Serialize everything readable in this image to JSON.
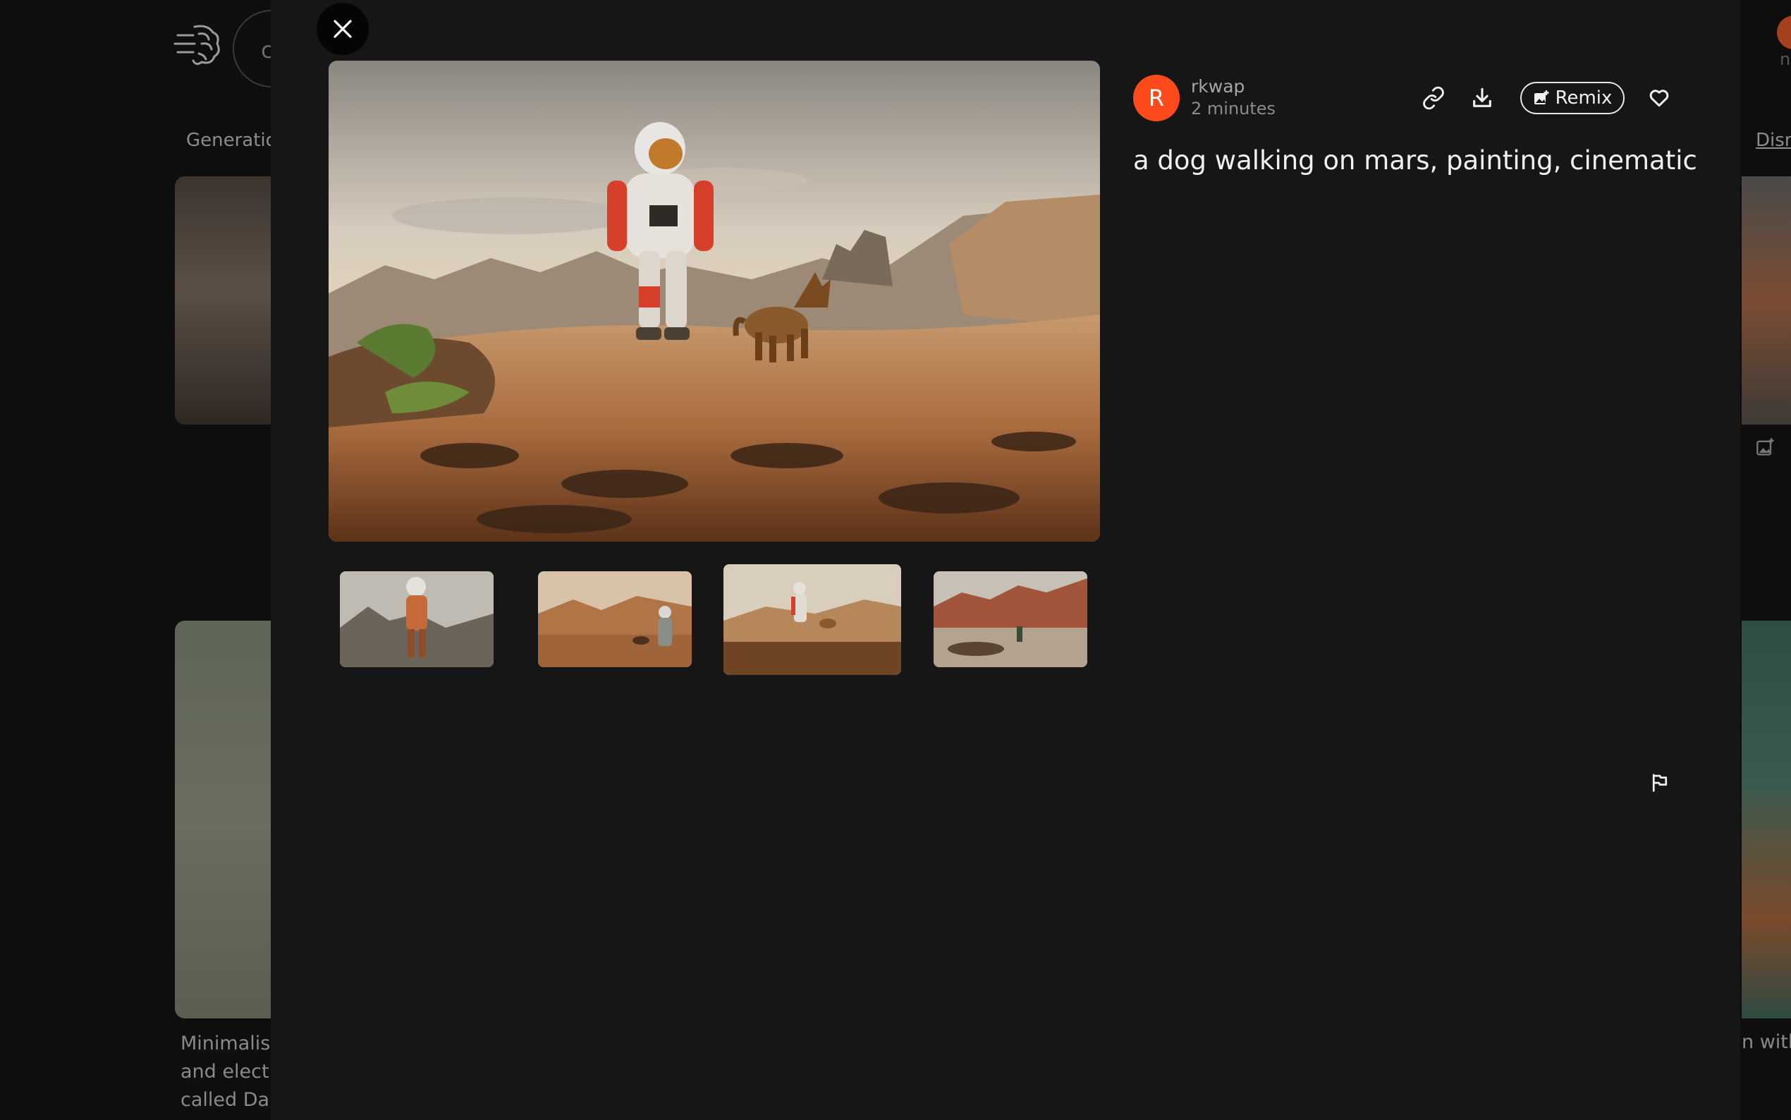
{
  "background": {
    "search_letter": "c",
    "tab_label": "Generatio",
    "dismiss_label": "Dism",
    "card_caption_lines": [
      "Minimalist",
      "and elect",
      "called Da"
    ],
    "right_caption": "n with",
    "right_letter": "n"
  },
  "modal": {
    "close_icon": "close-icon",
    "author": {
      "avatar_letter": "R",
      "username": "rkwap",
      "timestamp": "2 minutes",
      "avatar_color": "#ff4a1c"
    },
    "actions": {
      "link_icon": "link-icon",
      "download_icon": "download-icon",
      "remix_label": "Remix",
      "remix_icon": "image-plus-icon",
      "favorite_icon": "heart-icon",
      "report_icon": "flag-icon"
    },
    "prompt": "a dog walking on mars, painting, cinematic",
    "thumbnails": [
      {
        "alt": "astronaut standing among rocks",
        "selected": false
      },
      {
        "alt": "astronaut and dog in desert",
        "selected": false
      },
      {
        "alt": "astronaut with dog on rocky hill",
        "selected": true
      },
      {
        "alt": "distant figures in red canyon",
        "selected": false
      }
    ]
  },
  "colors": {
    "modal_bg": "#161616",
    "page_bg": "#0e0e0e",
    "accent": "#ff4a1c"
  }
}
